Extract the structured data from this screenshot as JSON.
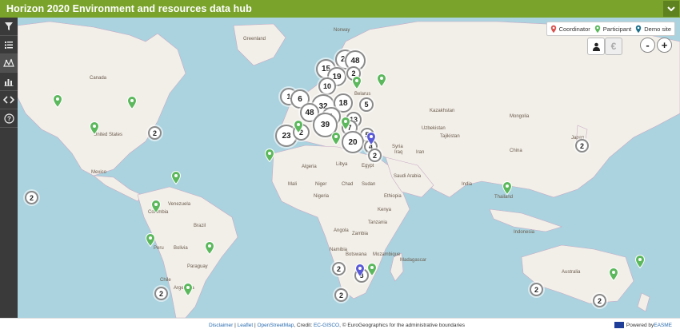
{
  "app": {
    "title": "Horizon 2020 Environment and resources data hub"
  },
  "sidebar": {
    "items": [
      {
        "name": "filter-icon"
      },
      {
        "name": "list-icon"
      },
      {
        "name": "cluster-map-icon"
      },
      {
        "name": "bar-chart-icon"
      },
      {
        "name": "embed-code-icon"
      },
      {
        "name": "help-icon"
      }
    ]
  },
  "legend": {
    "coordinator": "Coordinator",
    "participant": "Participant",
    "demo_site": "Demo site"
  },
  "legend_colors": {
    "coordinator": "#d9534f",
    "participant": "#5cb85c",
    "demo_site": "#1e6f8a"
  },
  "zoom": {
    "out": "-",
    "in": "+"
  },
  "clusters": [
    {
      "label": "15"
    },
    {
      "label": "20"
    },
    {
      "label": "48"
    },
    {
      "label": "19"
    },
    {
      "label": "2"
    },
    {
      "label": "10"
    },
    {
      "label": "1"
    },
    {
      "label": "6"
    },
    {
      "label": "32"
    },
    {
      "label": "18"
    },
    {
      "label": "5"
    },
    {
      "label": "48"
    },
    {
      "label": "1"
    },
    {
      "label": "13"
    },
    {
      "label": "39"
    },
    {
      "label": "7"
    },
    {
      "label": "5"
    },
    {
      "label": "23"
    },
    {
      "label": "2"
    },
    {
      "label": "20"
    },
    {
      "label": "4"
    },
    {
      "label": "2"
    },
    {
      "label": "2"
    },
    {
      "label": "2"
    },
    {
      "label": "2"
    },
    {
      "label": "2"
    },
    {
      "label": "8"
    },
    {
      "label": "2"
    },
    {
      "label": "2"
    },
    {
      "label": "2"
    },
    {
      "label": "2"
    },
    {
      "label": "2"
    }
  ],
  "map_labels": [
    "Canada",
    "United States",
    "Mexico",
    "Greenland",
    "Norway",
    "Belarus",
    "Kazakhstan",
    "Mongolia",
    "China",
    "Uzbekistan",
    "Tajikistan",
    "Iran",
    "Iraq",
    "Syria",
    "Egypt",
    "Algeria",
    "Libya",
    "Mali",
    "Niger",
    "Chad",
    "Sudan",
    "Ethiopia",
    "Nigeria",
    "Kenya",
    "Tanzania",
    "Angola",
    "Zambia",
    "Namibia",
    "Botswana",
    "Madagascar",
    "Brazil",
    "Peru",
    "Bolivia",
    "Colombia",
    "Venezuela",
    "India",
    "Indonesia",
    "Australia",
    "Japan",
    "Thailand",
    "Saudi Arabia",
    "Mozambique",
    "Argentina",
    "Chile",
    "Paraguay"
  ],
  "footer": {
    "disclaimer": "Disclaimer",
    "sep1": " | ",
    "leaflet": "Leaflet",
    "sep2": " | ",
    "osm": "OpenStreetMap",
    "credit_prefix": ", Credit: ",
    "ec_gisco": "EC-GISCO",
    "credit_suffix": ", © EuroGeographics for the administrative boundaries",
    "powered_prefix": "Powered by ",
    "powered_by": "EASME"
  }
}
